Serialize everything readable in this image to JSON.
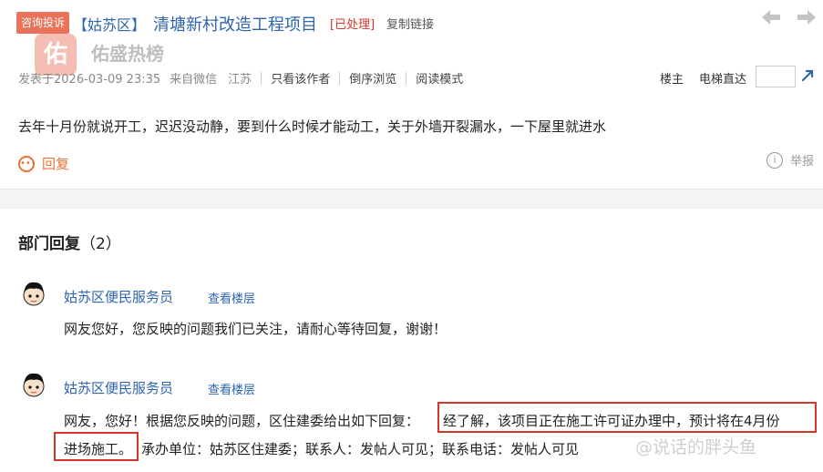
{
  "header": {
    "tag": "咨询投诉",
    "district": "【姑苏区】",
    "title": "清塘新村改造工程项目",
    "status": "[已处理]",
    "copy_link": "复制链接",
    "prev_icon": "arrow-left-icon",
    "next_icon": "arrow-right-icon"
  },
  "watermark": {
    "logo_char": "佑",
    "brand": "佑盛热榜"
  },
  "meta": {
    "posted": "发表于2026-03-09 23:35",
    "source": "来自微信",
    "province": "江苏",
    "only_author": "只看该作者",
    "reverse": "倒序浏览",
    "read_mode": "阅读模式"
  },
  "nav": {
    "floor_owner": "楼主",
    "elevator": "电梯直达",
    "jump_value": ""
  },
  "question": "去年十月份就说开工，迟迟没动静，要到什么时候才能动工，关于外墙开裂漏水，一下屋里就进水",
  "actions": {
    "reply": "回复",
    "report": "举报"
  },
  "replies_section": {
    "title": "部门回复",
    "count": "（2）"
  },
  "replies": [
    {
      "name": "姑苏区便民服务员",
      "view_floor": "查看楼层",
      "text": "网友您好，您反映的问题我们已关注，请耐心等待回复，谢谢！"
    },
    {
      "name": "姑苏区便民服务员",
      "view_floor": "查看楼层",
      "text_a": "网友，您好！根据您反映的问题，区住建委给出如下回复：",
      "text_highlight_1": "经了解，该项目正在施工许可证办理中，预计将在4月份",
      "text_highlight_2": "进场施工。",
      "text_b": "承办单位：姑苏区住建委；联系人：发帖人可见；联系电话：发帖人可见"
    }
  ],
  "footer_watermark": "@说话的胖头鱼",
  "colors": {
    "link_blue": "#2e64b0",
    "status_red": "#d9342b",
    "reply_orange": "#e8733a",
    "tag_bg": "#e8735a"
  }
}
